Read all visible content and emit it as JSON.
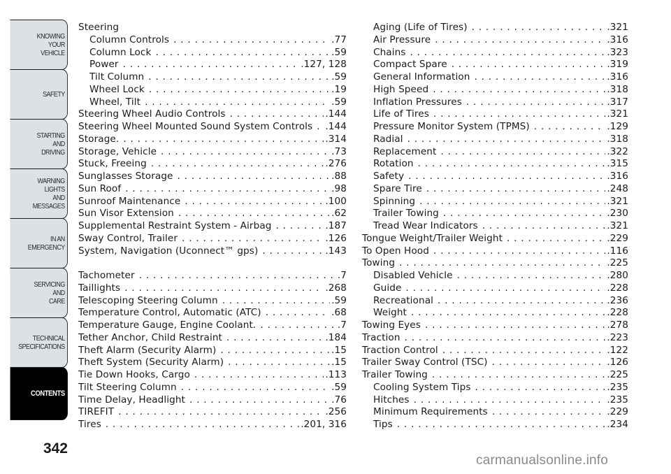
{
  "tabs": [
    {
      "lines": [
        "KNOWING",
        "YOUR",
        "VEHICLE"
      ],
      "active": false
    },
    {
      "lines": [
        "SAFETY"
      ],
      "active": false
    },
    {
      "lines": [
        "STARTING",
        "AND",
        "DRIVING"
      ],
      "active": false
    },
    {
      "lines": [
        "WARNING",
        "LIGHTS",
        "AND",
        "MESSAGES"
      ],
      "active": false
    },
    {
      "lines": [
        "IN AN",
        "EMERGENCY"
      ],
      "active": false
    },
    {
      "lines": [
        "SERVICING",
        "AND",
        "CARE"
      ],
      "active": false
    },
    {
      "lines": [
        "TECHNICAL",
        "SPECIFICATIONS"
      ],
      "active": false
    },
    {
      "lines": [
        "CONTENTS"
      ],
      "active": true
    }
  ],
  "page_number": "342",
  "left_column": [
    {
      "label": "Steering",
      "page": "",
      "level": 0
    },
    {
      "label": "Column Controls",
      "page": ".77",
      "level": 1
    },
    {
      "label": "Column Lock",
      "page": ".59",
      "level": 1
    },
    {
      "label": "Power",
      "page": ".127, 128",
      "level": 1
    },
    {
      "label": "Tilt Column",
      "page": ".59",
      "level": 1
    },
    {
      "label": "Wheel Lock",
      "page": ".19",
      "level": 1
    },
    {
      "label": "Wheel, Tilt",
      "page": ".59",
      "level": 1
    },
    {
      "label": "Steering Wheel Audio Controls",
      "page": ".144",
      "level": 0
    },
    {
      "label": "Steering Wheel Mounted Sound System Controls",
      "page": ".144",
      "level": 0
    },
    {
      "label": "Storage.",
      "page": ".314",
      "level": 0
    },
    {
      "label": "Storage, Vehicle",
      "page": ".73",
      "level": 0
    },
    {
      "label": "Stuck, Freeing",
      "page": ".276",
      "level": 0
    },
    {
      "label": "Sunglasses Storage",
      "page": ".88",
      "level": 0
    },
    {
      "label": "Sun Roof",
      "page": ".98",
      "level": 0
    },
    {
      "label": "Sunroof Maintenance",
      "page": ".100",
      "level": 0
    },
    {
      "label": "Sun Visor Extension",
      "page": ".62",
      "level": 0
    },
    {
      "label": "Supplemental Restraint System - Airbag",
      "page": ".187",
      "level": 0
    },
    {
      "label": "Sway Control, Trailer",
      "page": ".126",
      "level": 0
    },
    {
      "label": "System, Navigation (Uconnect™ gps)",
      "page": ".143",
      "level": 0
    },
    {
      "gap": true
    },
    {
      "label": "Tachometer",
      "page": ".7",
      "level": 0
    },
    {
      "label": "Taillights",
      "page": ".268",
      "level": 0
    },
    {
      "label": "Telescoping Steering Column",
      "page": ".59",
      "level": 0
    },
    {
      "label": "Temperature Control, Automatic (ATC)",
      "page": ".68",
      "level": 0
    },
    {
      "label": "Temperature Gauge, Engine Coolant.",
      "page": ".7",
      "level": 0
    },
    {
      "label": "Tether Anchor, Child Restraint",
      "page": ".184",
      "level": 0
    },
    {
      "label": "Theft Alarm (Security Alarm)",
      "page": ".15",
      "level": 0
    },
    {
      "label": "Theft System (Security Alarm)",
      "page": ".15",
      "level": 0
    },
    {
      "label": "Tie Down Hooks, Cargo",
      "page": ".113",
      "level": 0
    },
    {
      "label": "Tilt Steering Column",
      "page": ".59",
      "level": 0
    },
    {
      "label": "Time Delay, Headlight",
      "page": ".76",
      "level": 0
    },
    {
      "label": "TIREFIT",
      "page": ".256",
      "level": 0
    },
    {
      "label": "Tires",
      "page": ".201, 316",
      "level": 0
    }
  ],
  "right_column": [
    {
      "label": "Aging (Life of Tires)",
      "page": ".321",
      "level": 1
    },
    {
      "label": "Air Pressure",
      "page": ".316",
      "level": 1
    },
    {
      "label": "Chains",
      "page": ".323",
      "level": 1
    },
    {
      "label": "Compact Spare",
      "page": ".319",
      "level": 1
    },
    {
      "label": "General Information",
      "page": ".316",
      "level": 1
    },
    {
      "label": "High Speed",
      "page": ".318",
      "level": 1
    },
    {
      "label": "Inflation Pressures",
      "page": ".317",
      "level": 1
    },
    {
      "label": "Life of Tires",
      "page": ".321",
      "level": 1
    },
    {
      "label": "Pressure Monitor System (TPMS)",
      "page": ".129",
      "level": 1
    },
    {
      "label": "Radial",
      "page": ".318",
      "level": 1
    },
    {
      "label": "Replacement",
      "page": ".322",
      "level": 1
    },
    {
      "label": "Rotation",
      "page": ".315",
      "level": 1
    },
    {
      "label": "Safety",
      "page": ".316",
      "level": 1
    },
    {
      "label": "Spare Tire",
      "page": ".248",
      "level": 1
    },
    {
      "label": "Spinning",
      "page": ".321",
      "level": 1
    },
    {
      "label": "Trailer Towing",
      "page": ".230",
      "level": 1
    },
    {
      "label": "Tread Wear Indicators",
      "page": ".321",
      "level": 1
    },
    {
      "label": "Tongue Weight/Trailer Weight",
      "page": ".229",
      "level": 0
    },
    {
      "label": "To Open Hood",
      "page": ".116",
      "level": 0
    },
    {
      "label": "Towing",
      "page": ".225",
      "level": 0
    },
    {
      "label": "Disabled Vehicle",
      "page": ".280",
      "level": 1
    },
    {
      "label": "Guide",
      "page": ".228",
      "level": 1
    },
    {
      "label": "Recreational",
      "page": ".236",
      "level": 1
    },
    {
      "label": "Weight",
      "page": ".228",
      "level": 1
    },
    {
      "label": "Towing Eyes",
      "page": ".278",
      "level": 0
    },
    {
      "label": "Traction",
      "page": ".223",
      "level": 0
    },
    {
      "label": "Traction Control",
      "page": ".122",
      "level": 0
    },
    {
      "label": "Trailer Sway Control (TSC)",
      "page": ".126",
      "level": 0
    },
    {
      "label": "Trailer Towing",
      "page": ".225",
      "level": 0
    },
    {
      "label": "Cooling System Tips",
      "page": ".235",
      "level": 1
    },
    {
      "label": "Hitches",
      "page": ".235",
      "level": 1
    },
    {
      "label": "Minimum Requirements",
      "page": ".229",
      "level": 1
    },
    {
      "label": "Tips",
      "page": ".234",
      "level": 1
    }
  ],
  "watermark": "carmanualsonline.info",
  "colors": {
    "tab_bg": "#dde1e3",
    "tab_active_bg": "#000000",
    "text": "#1a1a1a",
    "watermark": "#8a8a8a"
  }
}
